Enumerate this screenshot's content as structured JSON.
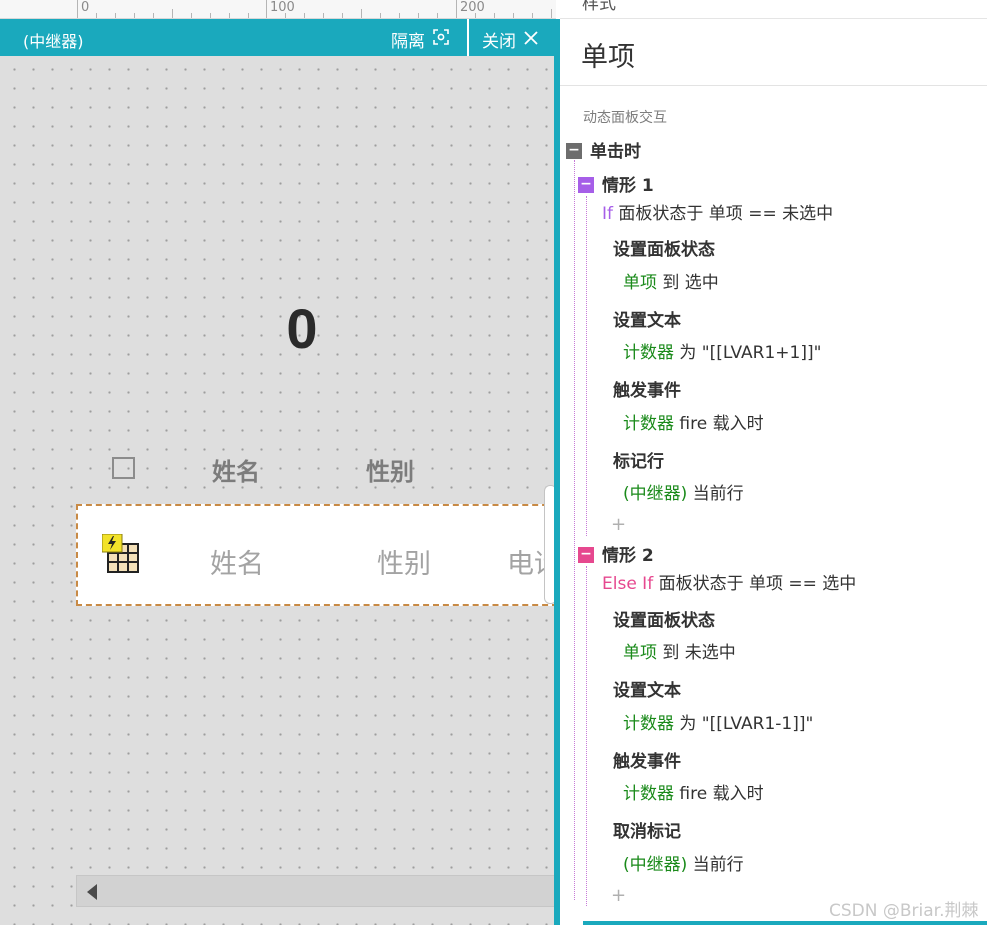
{
  "ruler": {
    "labels": [
      "0",
      "100",
      "200"
    ]
  },
  "repeater": {
    "title": "(中继器)",
    "isolate_label": "隔离",
    "close_label": "关闭",
    "counter_value": "0",
    "header": {
      "name": "姓名",
      "gender": "性别"
    },
    "row": {
      "name": "姓名",
      "gender": "性别",
      "phone": "电话"
    }
  },
  "panel": {
    "top_tab": "样式",
    "title": "单项",
    "section": "动态面板交互",
    "event": "单击时",
    "cases": [
      {
        "label": "情形 1",
        "cond_keyword": "If",
        "cond_text": "面板状态于 单项 == 未选中",
        "actions": [
          {
            "name": "设置面板状态",
            "target": "单项",
            "detail": "到 选中"
          },
          {
            "name": "设置文本",
            "target": "计数器",
            "detail": "为 \"[[LVAR1+1]]\""
          },
          {
            "name": "触发事件",
            "target": "计数器",
            "detail": "fire 载入时"
          },
          {
            "name": "标记行",
            "target": "(中继器)",
            "detail": "当前行"
          }
        ]
      },
      {
        "label": "情形 2",
        "cond_keyword": "Else If",
        "cond_text": "面板状态于 单项 == 选中",
        "actions": [
          {
            "name": "设置面板状态",
            "target": "单项",
            "detail": "到 未选中"
          },
          {
            "name": "设置文本",
            "target": "计数器",
            "detail": "为 \"[[LVAR1-1]]\""
          },
          {
            "name": "触发事件",
            "target": "计数器",
            "detail": "fire 载入时"
          },
          {
            "name": "取消标记",
            "target": "(中继器)",
            "detail": "当前行"
          }
        ]
      }
    ],
    "add_symbol": "+"
  },
  "watermark": "CSDN @Briar.荆棘",
  "colors": {
    "accent": "#1aa9bd",
    "case1": "#a65ee8",
    "case2": "#e6488f",
    "target": "#1a8a1a"
  }
}
